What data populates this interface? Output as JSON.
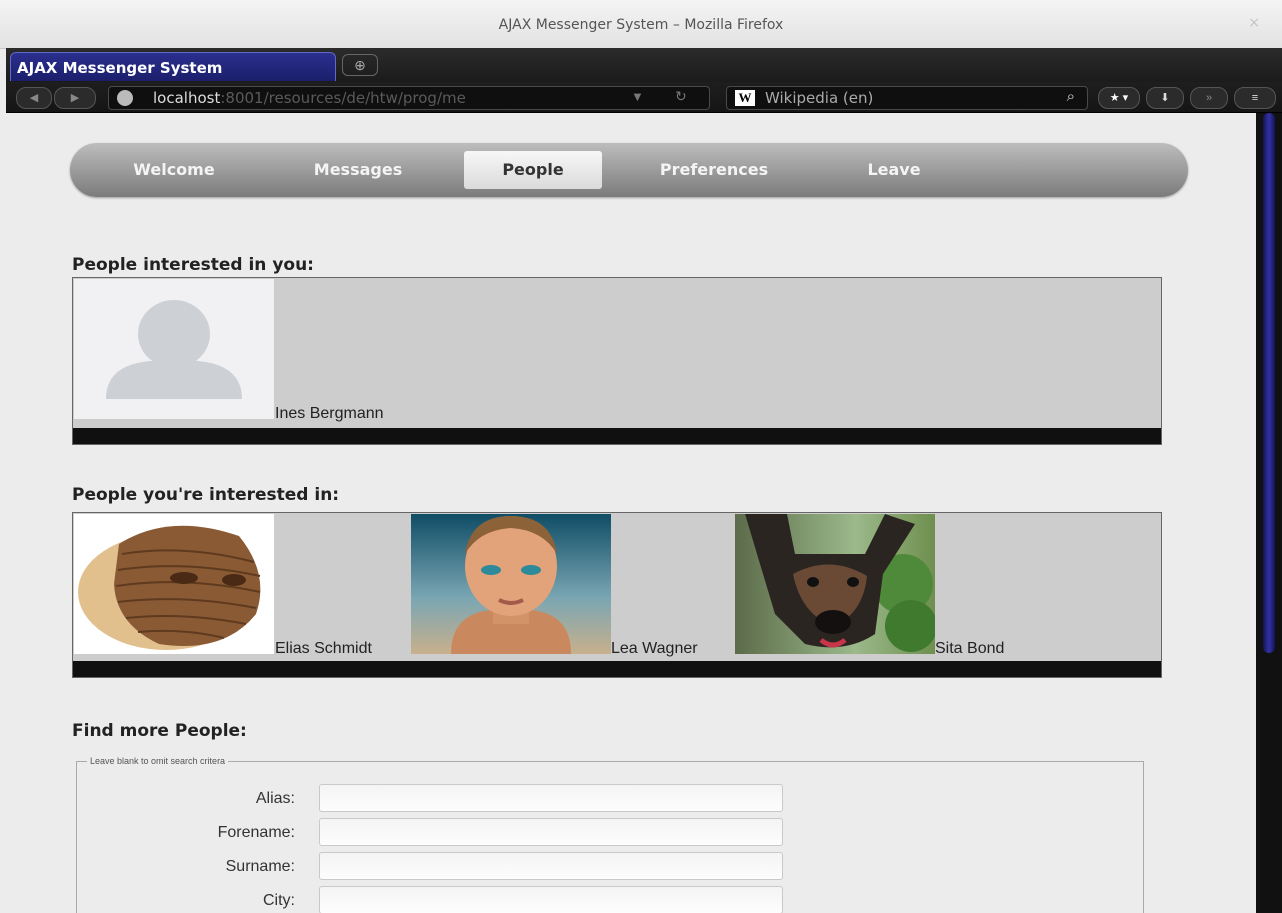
{
  "window": {
    "title": "AJAX Messenger System – Mozilla Firefox",
    "close_glyph": "×"
  },
  "tab": {
    "title": "AJAX Messenger System",
    "new_tab_glyph": "⊕"
  },
  "toolbar": {
    "url_host": "localhost",
    "url_path": ":8001/resources/de/htw/prog/me",
    "search_engine_logo": "W",
    "search_engine": "Wikipedia (en)"
  },
  "nav": {
    "items": [
      "Welcome",
      "Messages",
      "People",
      "Preferences",
      "Leave"
    ],
    "active": "People"
  },
  "interested_in_you": {
    "heading": "People interested in you:",
    "people": [
      {
        "name": "Ines Bergmann",
        "avatar": "default-silhouette"
      }
    ]
  },
  "you_are_interested_in": {
    "heading": "People you're interested in:",
    "people": [
      {
        "name": "Elias Schmidt",
        "avatar": "sculpted-wooden-face"
      },
      {
        "name": "Lea Wagner",
        "avatar": "woman-portrait"
      },
      {
        "name": "Sita Bond",
        "avatar": "dog-photo"
      }
    ]
  },
  "find_people": {
    "heading": "Find more People:",
    "legend": "Leave blank to omit search critera",
    "fields": [
      {
        "label": "Alias:",
        "value": ""
      },
      {
        "label": "Forename:",
        "value": ""
      },
      {
        "label": "Surname:",
        "value": ""
      },
      {
        "label": "City:",
        "value": ""
      }
    ]
  },
  "colors": {
    "menu_gradient_top": "#bdbdbd",
    "menu_gradient_bottom": "#7b7b7b",
    "tab_active": "#2b2f8e",
    "people_box_bg": "#cdcdcd"
  }
}
